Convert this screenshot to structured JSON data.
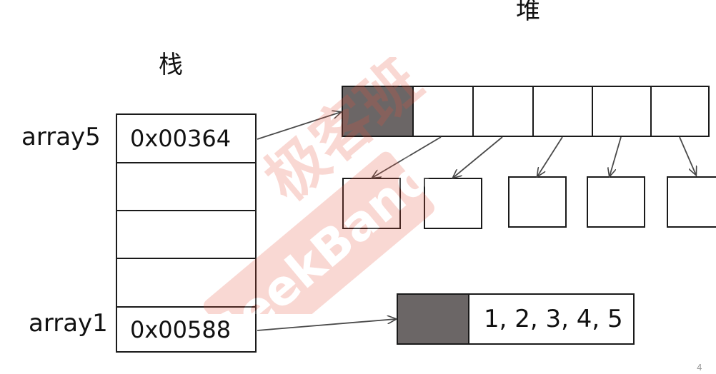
{
  "labels": {
    "stack_title": "栈",
    "heap_title": "堆"
  },
  "stack": {
    "variables": [
      {
        "name": "array5",
        "address": "0x00364"
      },
      {
        "name": "array1",
        "address": "0x00588"
      }
    ]
  },
  "heap": {
    "array1_values": "1, 2, 3, 4, 5"
  },
  "watermark": {
    "text": "GeekBand",
    "cn_text": "极客班",
    "color": "#e8523a"
  },
  "page_number": "4"
}
